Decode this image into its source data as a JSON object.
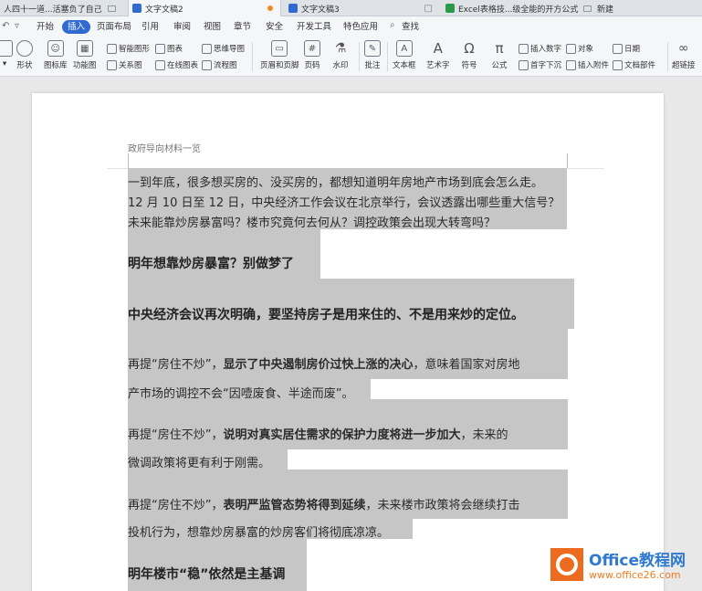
{
  "tabs": [
    {
      "label": "人四十一道...活塞负了自己"
    },
    {
      "label": "文字文稿2"
    },
    {
      "label": "文字文稿3"
    },
    {
      "label": "Excel表格技...级全能的开方公式"
    },
    {
      "label": "新建"
    }
  ],
  "menu": {
    "items": [
      "开始",
      "插入",
      "页面布局",
      "引用",
      "审阅",
      "视图",
      "章节",
      "安全",
      "开发工具",
      "特色应用"
    ],
    "search": "查找"
  },
  "ribbon": {
    "shape": "形状",
    "gallery": "图标库",
    "func": "功能图",
    "smartart": "智能图形",
    "chart": "图表",
    "mindmap": "思维导图",
    "relation": "关系图",
    "online_chart": "在线图表",
    "flowchart": "流程图",
    "header_footer": "页眉和页脚",
    "page_num": "页码",
    "watermark": "水印",
    "comment": "批注",
    "textbox": "文本框",
    "art": "艺术字",
    "symbol": "符号",
    "formula": "公式",
    "insert_num": "插入数字",
    "dropcap": "首字下沉",
    "object": "对象",
    "attach": "插入附件",
    "date": "日期",
    "docpart": "文档部件",
    "hyperlink": "超链接"
  },
  "document": {
    "header": "政府导向材料一览",
    "para1": [
      "一到年底，很多想买房的、没买房的，都想知道明年房地产市场到底会怎么走。",
      "12 月 10 日至 12 日，中央经济工作会议在北京举行，会议透露出哪些重大信号？",
      "未来能靠炒房暴富吗？楼市究竟何去何从？调控政策会出现大转弯吗？"
    ],
    "heading1": "明年想靠炒房暴富？别做梦了",
    "heading2": "中央经济会议再次明确，要坚持房子是用来住的、不是用来炒的定位。",
    "p3": {
      "a": "再提“房住不炒”，",
      "b": "显示了中央遏制房价过快上涨的决心",
      "c": "，意味着国家对房地",
      "d": "产市场的调控不会“因噎废食、半途而废”。"
    },
    "p4": {
      "a": "再提“房住不炒”，",
      "b": "说明对真实居住需求的保护力度将进一步加大",
      "c": "，未来的",
      "d": "微调政策将更有利于刚需。"
    },
    "p5": {
      "a": "再提“房住不炒”，",
      "b": "表明严监管态势将得到延续",
      "c": "，未来楼市政策将会继续打击",
      "d": "投机行为，想靠炒房暴富的炒房客们将彻底凉凉。"
    },
    "heading3": "明年楼市“稳”依然是主基调"
  },
  "watermark": {
    "brand": "Office教程网",
    "url": "www.office26.com"
  },
  "colors": {
    "accent": "#2f6bd1",
    "selection": "#c6c6c6",
    "brand_orange": "#ec6b1e"
  }
}
